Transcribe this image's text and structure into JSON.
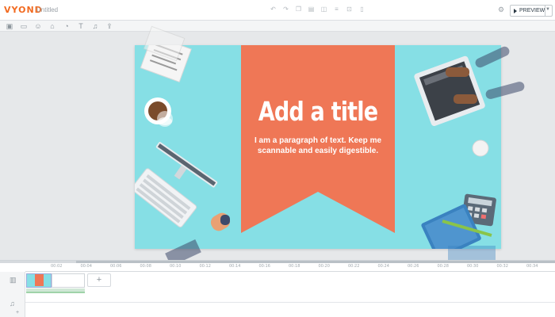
{
  "app": {
    "logo": "VYOND",
    "document_title": "Untitled",
    "preview_label": "PREVIEW"
  },
  "toolbar": {
    "top_icons": [
      "undo-icon",
      "redo-icon",
      "copy-icon",
      "paste-icon",
      "layer-icon",
      "align-icon",
      "lock-icon",
      "delete-icon"
    ],
    "asset_icons": [
      "template-icon",
      "props-icon",
      "characters-icon",
      "chart-icon",
      "audio-icon",
      "text-icon",
      "music-icon",
      "upload-icon"
    ]
  },
  "slide": {
    "title": "Add a title",
    "body": "I am a paragraph of text. Keep me scannable and easily digestible.",
    "background_color": "#86dfe5",
    "banner_color": "#ef7756"
  },
  "timeline": {
    "ticks": [
      "00:02",
      "00:04",
      "00:06",
      "00:08",
      "00:10",
      "00:12",
      "00:14",
      "00:16",
      "00:18",
      "00:20",
      "00:22",
      "00:24",
      "00:26",
      "00:28",
      "00:30",
      "00:32",
      "00:34",
      "00:36"
    ],
    "add_scene_label": "+"
  },
  "colors": {
    "accent": "#f26b21"
  }
}
